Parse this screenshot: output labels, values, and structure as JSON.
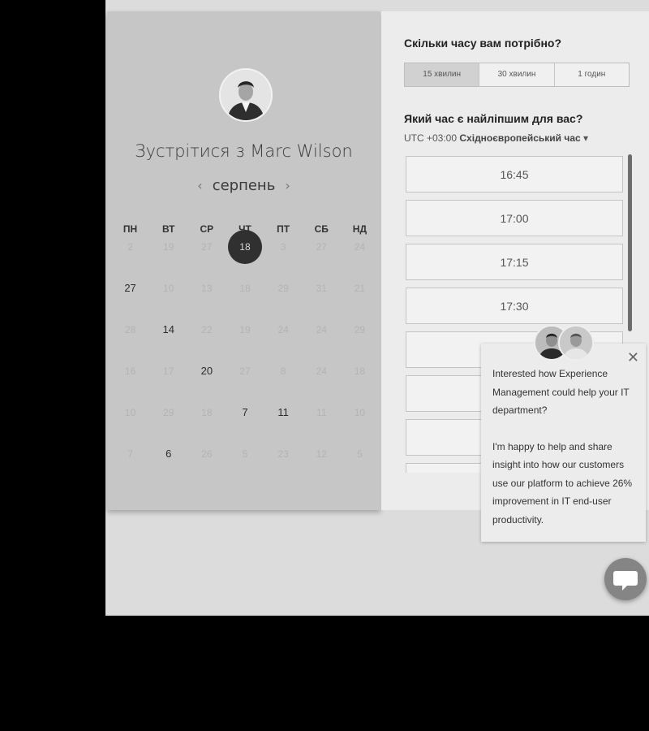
{
  "host": {
    "meet_title": "Зустрітися з Marc Wilson"
  },
  "calendar": {
    "month": "серпень",
    "prev_arrow": "‹",
    "next_arrow": "›",
    "weekdays": [
      "ПН",
      "ВТ",
      "СР",
      "ЧТ",
      "ПТ",
      "СБ",
      "НД"
    ],
    "rows": [
      [
        {
          "d": "2"
        },
        {
          "d": "19"
        },
        {
          "d": "27"
        },
        {
          "d": "18",
          "sel": true
        },
        {
          "d": "3"
        },
        {
          "d": "27"
        },
        {
          "d": "24"
        }
      ],
      [
        {
          "d": "27",
          "avail": true
        },
        {
          "d": "10"
        },
        {
          "d": "13"
        },
        {
          "d": "18"
        },
        {
          "d": "29"
        },
        {
          "d": "31"
        },
        {
          "d": "21"
        }
      ],
      [
        {
          "d": "28"
        },
        {
          "d": "14",
          "avail": true
        },
        {
          "d": "22"
        },
        {
          "d": "19"
        },
        {
          "d": "24"
        },
        {
          "d": "24"
        },
        {
          "d": "29"
        }
      ],
      [
        {
          "d": "16"
        },
        {
          "d": "17"
        },
        {
          "d": "20",
          "avail": true
        },
        {
          "d": "27"
        },
        {
          "d": "8"
        },
        {
          "d": "24"
        },
        {
          "d": "18"
        }
      ],
      [
        {
          "d": "10"
        },
        {
          "d": "29"
        },
        {
          "d": "18"
        },
        {
          "d": "7",
          "avail": true
        },
        {
          "d": "11",
          "avail": true
        },
        {
          "d": "11"
        },
        {
          "d": "10"
        }
      ],
      [
        {
          "d": "7"
        },
        {
          "d": "6",
          "avail": true
        },
        {
          "d": "26"
        },
        {
          "d": "5"
        },
        {
          "d": "23"
        },
        {
          "d": "12"
        },
        {
          "d": "5"
        }
      ]
    ]
  },
  "duration": {
    "question": "Скільки часу вам потрібно?",
    "options": [
      "15 хвилин",
      "30 хвилин",
      "1 годин"
    ],
    "active_index": 0
  },
  "time": {
    "question": "Який час є найліпшим для вас?",
    "tz_offset": "UTC +03:00",
    "tz_name": "Східноєвропейський час",
    "slots": [
      "16:45",
      "17:00",
      "17:15",
      "17:30",
      "",
      "",
      "",
      ""
    ]
  },
  "popup": {
    "close": "✕",
    "paragraph1": "Interested how Experience Management could help your IT department?",
    "paragraph2": "I'm happy to help and share insight into how our customers use our platform to achieve 26% improvement in IT end-user productivity."
  }
}
